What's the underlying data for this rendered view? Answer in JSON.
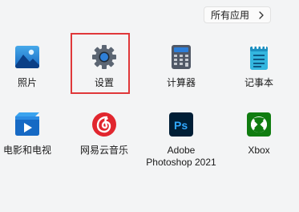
{
  "header": {
    "all_apps_label": "所有应用"
  },
  "apps": [
    {
      "label": "照片",
      "icon": "photos-icon"
    },
    {
      "label": "设置",
      "icon": "settings-gear-icon"
    },
    {
      "label": "计算器",
      "icon": "calculator-icon"
    },
    {
      "label": "记事本",
      "icon": "notepad-icon"
    },
    {
      "label": "电影和电视",
      "icon": "movies-tv-icon"
    },
    {
      "label": "网易云音乐",
      "icon": "netease-music-icon"
    },
    {
      "label_line1": "Adobe",
      "label_line2": "Photoshop 2021",
      "icon": "photoshop-icon"
    },
    {
      "label": "Xbox",
      "icon": "xbox-icon"
    }
  ],
  "highlight": {
    "target": "设置",
    "color": "#e0383a"
  },
  "colors": {
    "background": "#f3f4f5",
    "photos": "#1b7fd0",
    "settings": "#5b6674",
    "calculator": "#4d5563",
    "notepad": "#2db5dc",
    "movies": "#1570c6",
    "netease": "#e0242d",
    "photoshop": "#001e36",
    "xbox": "#107c10"
  }
}
